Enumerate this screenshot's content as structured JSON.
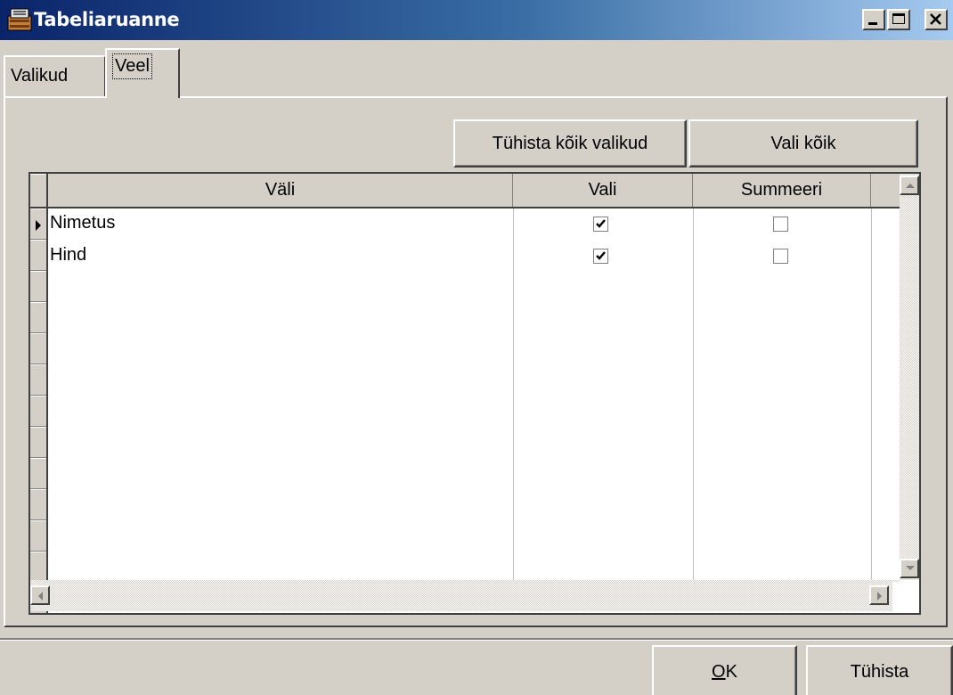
{
  "window": {
    "title": "Tabeliaruanne",
    "app_icon": "app-icon",
    "controls": [
      "minimize-icon",
      "maximize-icon",
      "close-icon"
    ]
  },
  "tabs": [
    {
      "label": "Valikud",
      "active": false
    },
    {
      "label": "Veel",
      "active": true
    }
  ],
  "toolbar": {
    "clear_all_label": "Tühista kõik valikud",
    "select_all_label": "Vali kõik"
  },
  "grid": {
    "columns": [
      "Väli",
      "Vali",
      "Summeeri"
    ],
    "rows": [
      {
        "field": "Nimetus",
        "select": true,
        "sum": false,
        "current": true
      },
      {
        "field": "Hind",
        "select": true,
        "sum": false,
        "current": false
      }
    ]
  },
  "footer": {
    "ok_label": "OK",
    "ok_access_key": "O",
    "ok_rest": "K",
    "cancel_label": "Tühista"
  }
}
